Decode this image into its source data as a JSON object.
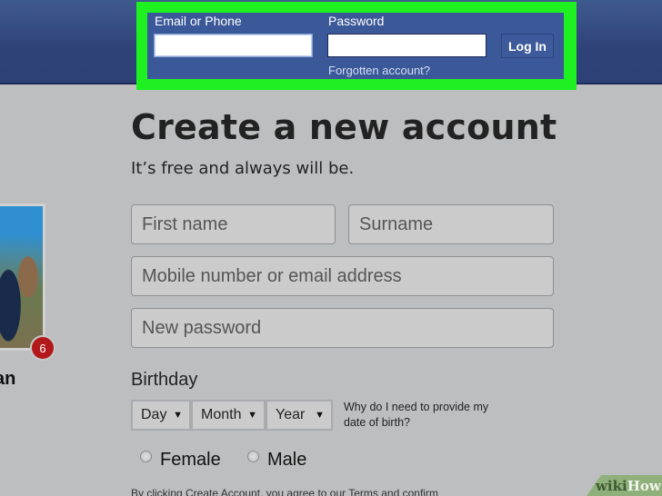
{
  "header": {
    "email_label": "Email or Phone",
    "email_value": "",
    "password_label": "Password",
    "password_value": "",
    "login_button": "Log In",
    "forgot_link": "Forgotten account?"
  },
  "signup": {
    "title": "Create a new account",
    "subtitle": "It’s free and always will be.",
    "first_name_placeholder": "First name",
    "surname_placeholder": "Surname",
    "contact_placeholder": "Mobile number or email address",
    "password_placeholder": "New password",
    "birthday_label": "Birthday",
    "day": "Day",
    "month": "Month",
    "year": "Year",
    "why_birthday": "Why do I need to provide my date of birth?",
    "gender_female": "Female",
    "gender_male": "Male",
    "terms": "By clicking Create Account, you agree to our Terms and confirm"
  },
  "profile": {
    "name_fragment": "an",
    "badge_count": "6"
  },
  "watermark": {
    "wiki": "wiki",
    "how": "How"
  },
  "colors": {
    "header_blue": "#2f4278",
    "login_box": "#3b5898",
    "highlight_green": "#1ef022",
    "badge_red": "#b3191c"
  }
}
